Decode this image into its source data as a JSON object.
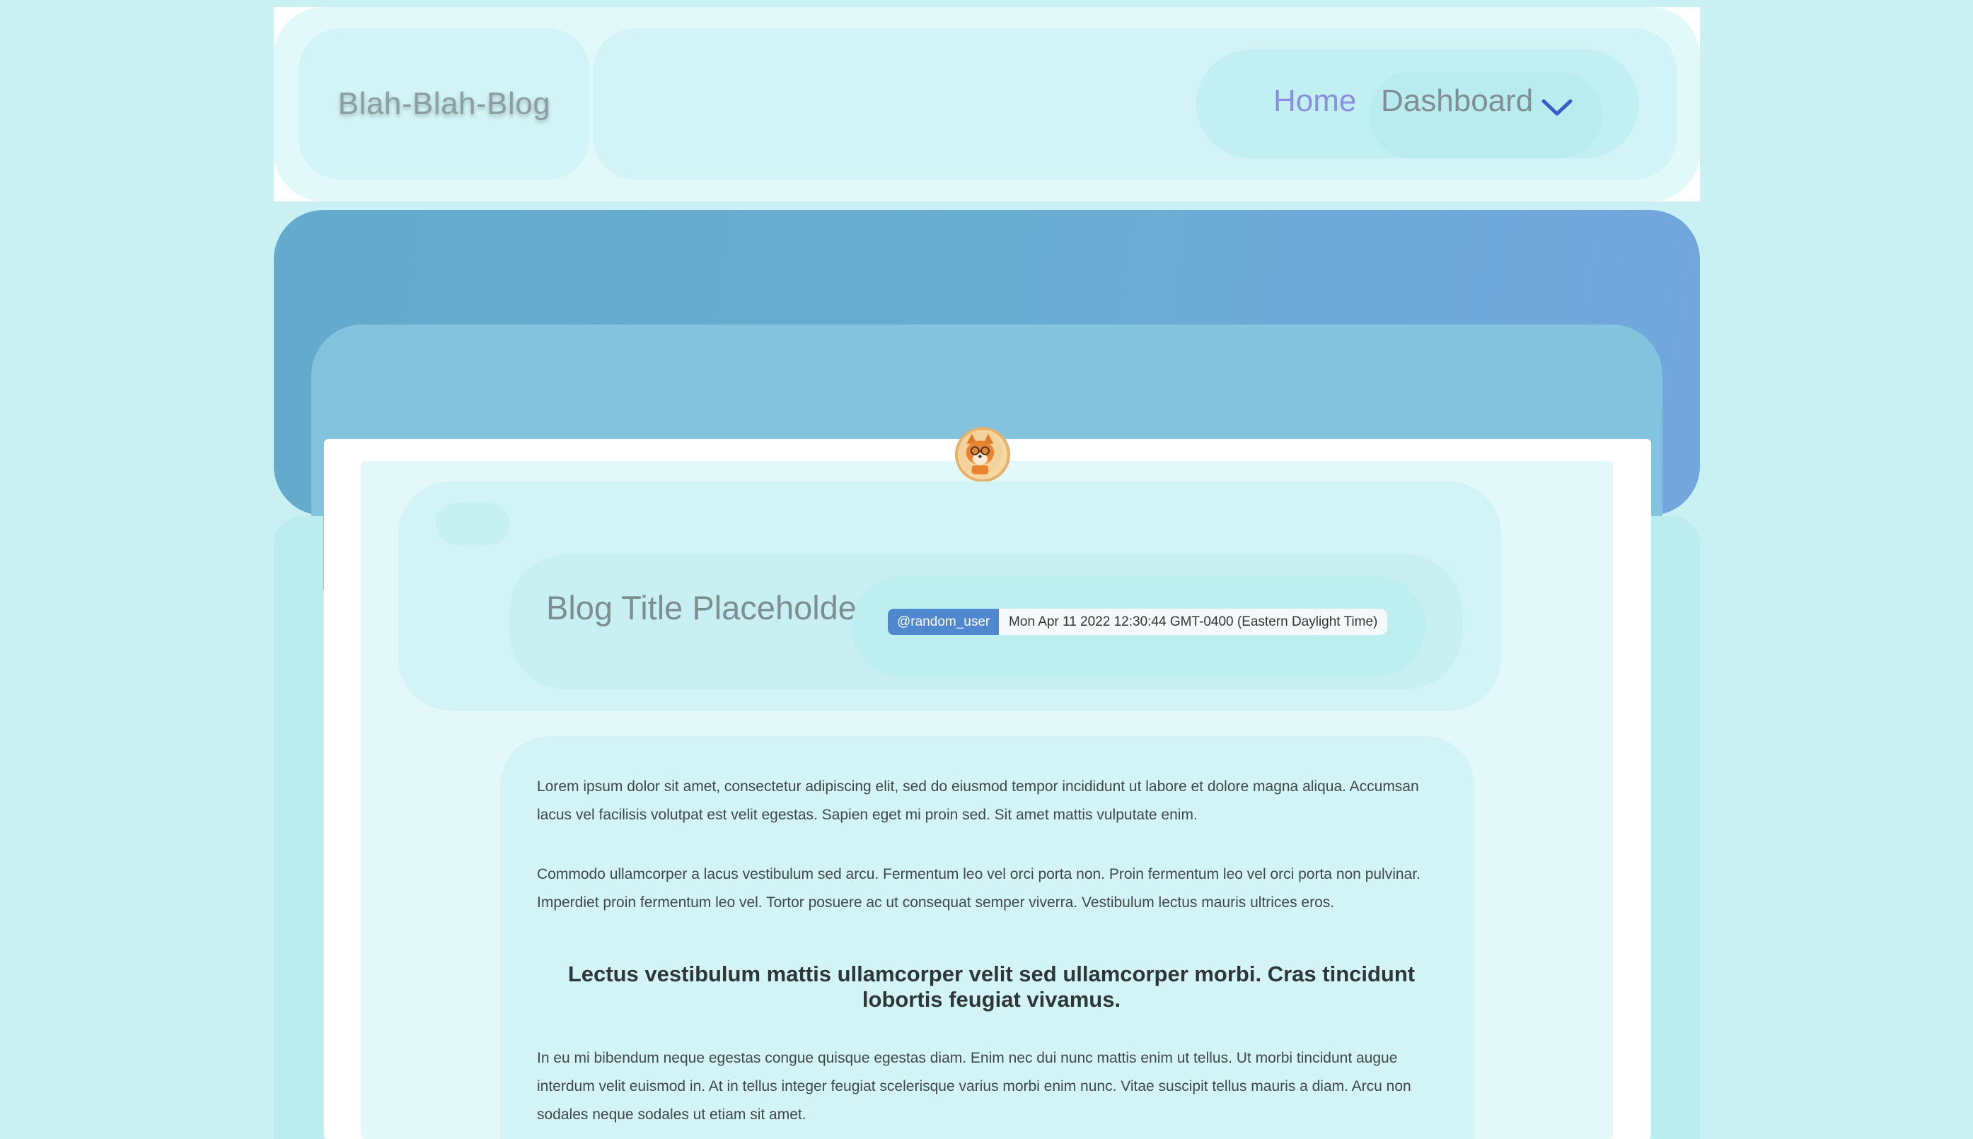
{
  "header": {
    "brand": "Blah-Blah-Blog",
    "nav": {
      "home_label": "Home",
      "dashboard_label": "Dashboard"
    }
  },
  "post": {
    "title": "Blog Title Placeholder..",
    "author": "@random_user",
    "date": "Mon Apr 11 2022 12:30:44 GMT-0400 (Eastern Daylight Time)",
    "paragraphs": [
      "Lorem ipsum dolor sit amet, consectetur adipiscing elit, sed do eiusmod tempor incididunt ut labore et dolore magna aliqua. Accumsan lacus vel facilisis volutpat est velit egestas. Sapien eget mi proin sed. Sit amet mattis vulputate enim.",
      "Commodo ullamcorper a lacus vestibulum sed arcu. Fermentum leo vel orci porta non. Proin fermentum leo vel orci porta non pulvinar. Imperdiet proin fermentum leo vel. Tortor posuere ac ut consequat semper viverra. Vestibulum lectus mauris ultrices eros.",
      "In eu mi bibendum neque egestas congue quisque egestas diam. Enim nec dui nunc mattis enim ut tellus. Ut morbi tincidunt augue interdum velit euismod in. At in tellus integer feugiat scelerisque varius morbi enim nunc. Vitae suscipit tellus mauris a diam. Arcu non sodales neque sodales ut etiam sit amet."
    ],
    "heading": "Lectus vestibulum mattis ullamcorper velit sed ullamcorper morbi. Cras tincidunt lobortis feugiat vivamus."
  },
  "icons": {
    "dropdown": "chevron-down-icon",
    "avatar": "fox-avatar"
  },
  "colors": {
    "page_bg": "#c9f1f3",
    "hero_gradient_start": "#63aacc",
    "hero_gradient_end": "#72a6dd",
    "author_badge": "#4f88cf",
    "nav_link": "#8a8fe0"
  }
}
